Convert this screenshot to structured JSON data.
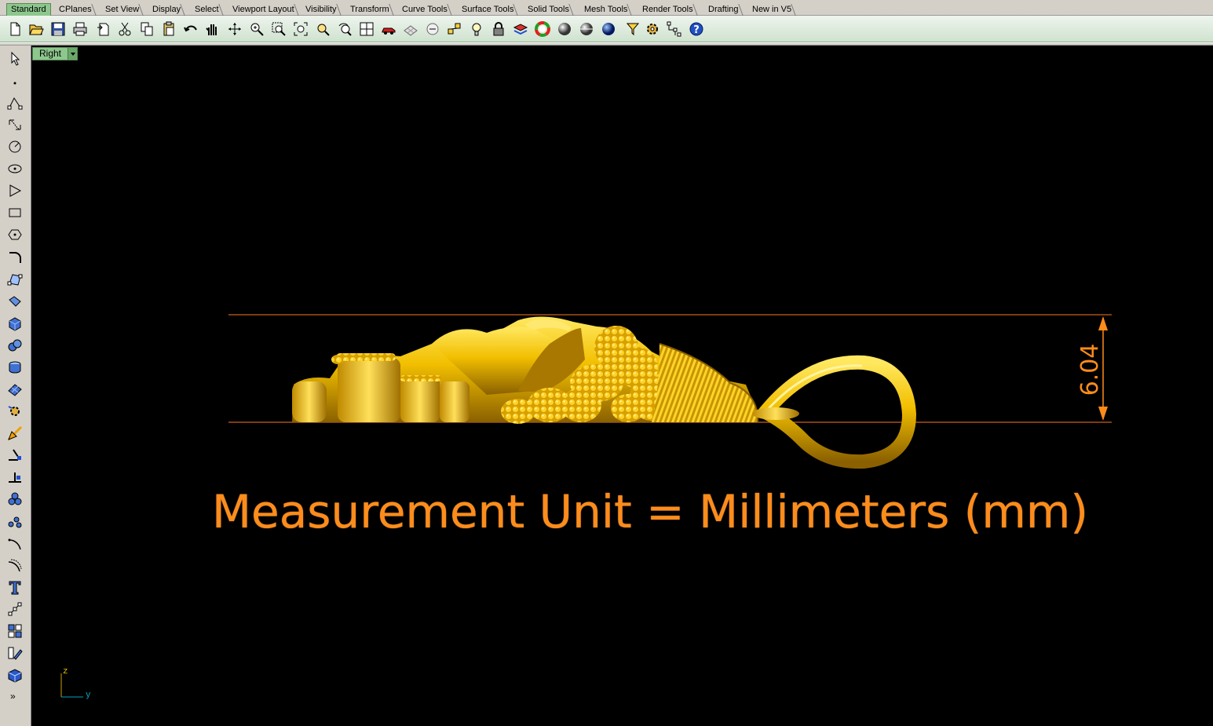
{
  "tabs": [
    {
      "label": "Standard",
      "active": true
    },
    {
      "label": "CPlanes"
    },
    {
      "label": "Set View"
    },
    {
      "label": "Display"
    },
    {
      "label": "Select"
    },
    {
      "label": "Viewport Layout"
    },
    {
      "label": "Visibility"
    },
    {
      "label": "Transform"
    },
    {
      "label": "Curve Tools"
    },
    {
      "label": "Surface Tools"
    },
    {
      "label": "Solid Tools"
    },
    {
      "label": "Mesh Tools"
    },
    {
      "label": "Render Tools"
    },
    {
      "label": "Drafting"
    },
    {
      "label": "New in V5"
    }
  ],
  "toolbar": {
    "icons": [
      "new-file-icon",
      "open-folder-icon",
      "save-icon",
      "print-icon",
      "import-icon",
      "cut-icon",
      "copy-icon",
      "paste-icon",
      "undo-icon",
      "pan-hand-icon",
      "rotate-view-icon",
      "zoom-dynamic-icon",
      "zoom-window-icon",
      "zoom-extents-icon",
      "zoom-selected-icon",
      "undo-view-icon",
      "viewport-layout-icon",
      "car-object-icon",
      "grid-snap-icon",
      "cplane-icon",
      "object-snap-icon",
      "light-bulb-icon",
      "lock-icon",
      "layer-icon",
      "color-wheel-icon",
      "shaded-sphere-icon",
      "rendered-sphere-icon",
      "blue-sphere-icon",
      "filter-icon",
      "settings-gear-icon",
      "dimension-icon",
      "help-icon"
    ]
  },
  "left_toolbar": {
    "icons": [
      "select-arrow-icon",
      "point-icon",
      "polyline-icon",
      "curve-icon",
      "circle-icon",
      "ellipse-icon",
      "polygon-icon",
      "rectangle-icon",
      "hexagon-icon",
      "fillet-curve-icon",
      "surface-points-icon",
      "extrude-surface-icon",
      "box-solid-icon",
      "boolean-union-icon",
      "cylinder-icon",
      "mesh-icon",
      "transform-gear-icon",
      "analyze-icon",
      "dimension-tool-icon",
      "text-align-icon",
      "boolean-ops-icon",
      "array-icon",
      "rotate-curve-icon",
      "offset-curve-icon",
      "text-object-icon",
      "snap-points-icon",
      "group-icon",
      "edit-icon",
      "render-box-icon"
    ],
    "more_label": "»"
  },
  "viewport": {
    "title": "Right",
    "dimension_value": "6.04",
    "caption": "Measurement Unit = Millimeters (mm)",
    "axis_z": "z",
    "axis_y": "y"
  },
  "colors": {
    "dimension": "#ff8c1a",
    "gold": "#e8b400",
    "viewport_bg": "#000000",
    "active_tab": "#8dc78d"
  }
}
